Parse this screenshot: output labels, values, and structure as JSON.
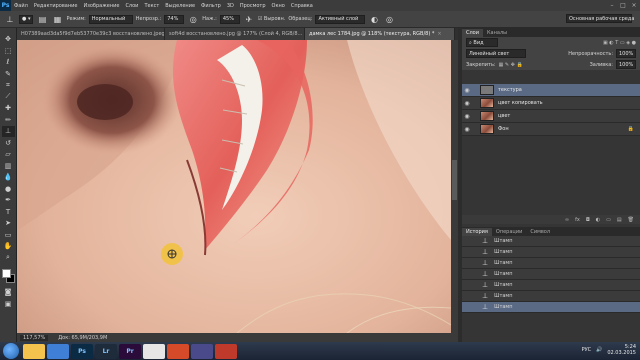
{
  "app": {
    "logo": "Ps"
  },
  "menu": [
    "Файл",
    "Редактирование",
    "Изображение",
    "Слои",
    "Текст",
    "Выделение",
    "Фильтр",
    "3D",
    "Просмотр",
    "Окно",
    "Справка"
  ],
  "options": {
    "mode_label": "Режим:",
    "mode_value": "Нормальный",
    "opacity_label": "Непрозр.:",
    "opacity_value": "74%",
    "flow_label": "Наж.:",
    "flow_value": "45%",
    "aligned_label": "Выровн.",
    "sample_label": "Образец:",
    "sample_value": "Активный слой",
    "workspace": "Основная рабочая среда"
  },
  "doc_tabs": [
    {
      "label": "H07389aad3da5f9d7eb53770e39c3 восстановлено.jpeg",
      "active": false
    },
    {
      "label": "soft4d восстановлено.jpg @ 177% (Слой 4, RGB/8...",
      "active": false
    },
    {
      "label": "дамка лес 1784.jpg @ 118% (текстура, RGB/8) *",
      "active": true
    }
  ],
  "status": {
    "zoom": "117,57%",
    "doc": "Док: 65,9M/203,9M"
  },
  "layers_panel": {
    "tabs": [
      "Слои",
      "Каналы"
    ],
    "filter_label": "Вид",
    "blend_mode": "Линейный свет",
    "opacity_label": "Непрозрачность:",
    "opacity_value": "100%",
    "lock_label": "Закрепить:",
    "fill_label": "Заливка:",
    "fill_value": "100%",
    "layers": [
      {
        "name": "текстура",
        "thumb": "gray",
        "selected": true,
        "locked": false
      },
      {
        "name": "цвет копировать",
        "thumb": "face",
        "selected": false,
        "locked": false
      },
      {
        "name": "цвет",
        "thumb": "face",
        "selected": false,
        "locked": false
      },
      {
        "name": "Фон",
        "thumb": "face",
        "selected": false,
        "locked": true
      }
    ]
  },
  "history_panel": {
    "tabs": [
      "История",
      "Операции",
      "Символ"
    ],
    "items": [
      "Штамп",
      "Штамп",
      "Штамп",
      "Штамп",
      "Штамп",
      "Штамп",
      "Штамп"
    ],
    "selected_index": 6
  },
  "taskbar": {
    "apps": [
      {
        "icon": "explorer-icon",
        "label": "",
        "color": "#f3c34d"
      },
      {
        "icon": "video-icon",
        "label": "",
        "color": "#3f7fd6"
      },
      {
        "icon": "photoshop-icon",
        "label": "Ps",
        "color": "#0b2a44"
      },
      {
        "icon": "lightroom-icon",
        "label": "Lr",
        "color": "#1d2b3b"
      },
      {
        "icon": "premiere-icon",
        "label": "Pr",
        "color": "#2a0b3a"
      },
      {
        "icon": "chrome-icon",
        "label": "",
        "color": "#e6e6e6"
      },
      {
        "icon": "app-icon",
        "label": "",
        "color": "#d54b2a"
      },
      {
        "icon": "app2-icon",
        "label": "",
        "color": "#4a4a8a"
      },
      {
        "icon": "app3-icon",
        "label": "",
        "color": "#c03a2b"
      }
    ],
    "lang": "РУС",
    "time": "5:24",
    "date": "02.03.2015"
  }
}
